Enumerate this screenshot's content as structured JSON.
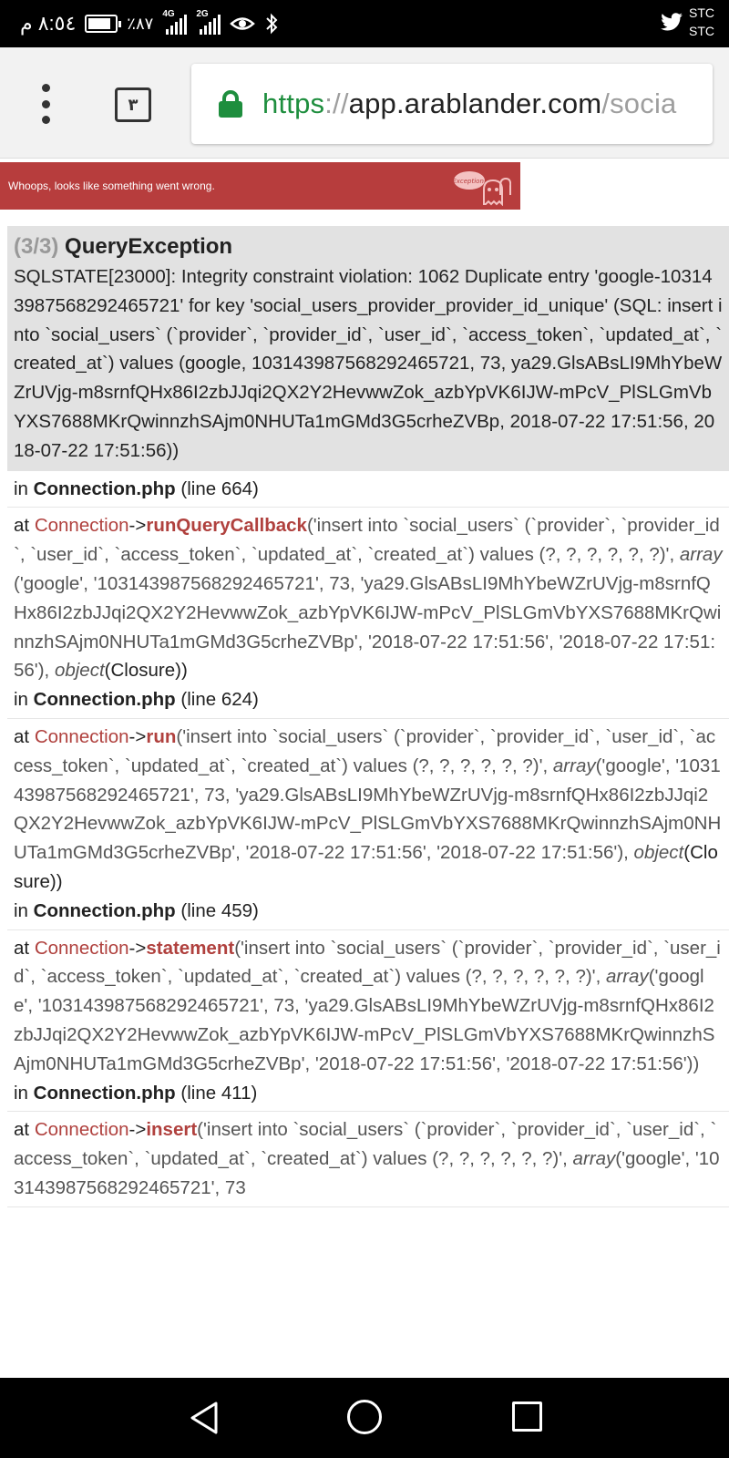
{
  "status_bar": {
    "time": "٨:٥٤ م",
    "battery_percent": "٪٨٧",
    "battery_level": 0.87,
    "net1": "4G",
    "net2": "2G",
    "carrier1": "STC",
    "carrier2": "STC",
    "icons": [
      "battery-icon",
      "signal-icon",
      "eye-icon",
      "bluetooth-icon",
      "twitter-icon"
    ]
  },
  "browser": {
    "tab_count": "٣",
    "url_scheme": "https",
    "url_sep": "://",
    "url_host": "app.arablander.com",
    "url_path": "/socia"
  },
  "banner": {
    "text": "Whoops, looks like something went wrong.",
    "logo_text": "Exception!",
    "color": "#b73d3d"
  },
  "exception": {
    "count": "(3/3)",
    "class": "QueryException",
    "message": "SQLSTATE[23000]: Integrity constraint violation: 1062 Duplicate entry 'google-103143987568292465721' for key 'social_users_provider_provider_id_unique' (SQL: insert into `social_users` (`provider`, `provider_id`, `user_id`, `access_token`, `updated_at`, `created_at`) values (google, 103143987568292465721, 73, ya29.GlsABsLI9MhYbeWZrUVjg-m8srnfQHx86I2zbJJqi2QX2Y2HevwwZok_azbYpVK6IJW-mPcV_PlSLGmVbYXS7688MKrQwinnzhSAjm0NHUTa1mGMd3G5crheZVBp, 2018-07-22 17:51:56, 2018-07-22 17:51:56))"
  },
  "trace": {
    "in_label": "in",
    "at_label": "at",
    "frame0": {
      "file": "Connection.php",
      "line": "(line 664)"
    },
    "frame1": {
      "class": "Connection",
      "arrow": "->",
      "method": "runQueryCallback",
      "args_a": "('insert into `social_users` (`provider`, `provider_id`, `user_id`, `access_token`, `updated_at`, `created_at`) values (?, ?, ?, ?, ?, ?)', ",
      "array_kw": "array",
      "args_b": "('google', '103143987568292465721', 73, 'ya29.GlsABsLI9MhYbeWZrUVjg-m8srnfQHx86I2zbJJqi2QX2Y2HevwwZok_azbYpVK6IJW-mPcV_PlSLGmVbYXS7688MKrQwinnzhSAjm0NHUTa1mGMd3G5crheZVBp', '2018-07-22 17:51:56', '2018-07-22 17:51:56'), ",
      "object_kw": "object",
      "args_c": "(Closure))",
      "file": "Connection.php",
      "line": "(line 624)"
    },
    "frame2": {
      "class": "Connection",
      "arrow": "->",
      "method": "run",
      "args_a": "('insert into `social_users` (`provider`, `provider_id`, `user_id`, `access_token`, `updated_at`, `created_at`) values (?, ?, ?, ?, ?, ?)', ",
      "array_kw": "array",
      "args_b": "('google', '103143987568292465721', 73, 'ya29.GlsABsLI9MhYbeWZrUVjg-m8srnfQHx86I2zbJJqi2QX2Y2HevwwZok_azbYpVK6IJW-mPcV_PlSLGmVbYXS7688MKrQwinnzhSAjm0NHUTa1mGMd3G5crheZVBp', '2018-07-22 17:51:56', '2018-07-22 17:51:56'), ",
      "object_kw": "object",
      "args_c": "(Closure))",
      "file": "Connection.php",
      "line": "(line 459)"
    },
    "frame3": {
      "class": "Connection",
      "arrow": "->",
      "method": "statement",
      "args_a": "('insert into `social_users` (`provider`, `provider_id`, `user_id`, `access_token`, `updated_at`, `created_at`) values (?, ?, ?, ?, ?, ?)', ",
      "array_kw": "array",
      "args_b": "('google', '103143987568292465721', 73, 'ya29.GlsABsLI9MhYbeWZrUVjg-m8srnfQHx86I2zbJJqi2QX2Y2HevwwZok_azbYpVK6IJW-mPcV_PlSLGmVbYXS7688MKrQwinnzhSAjm0NHUTa1mGMd3G5crheZVBp', '2018-07-22 17:51:56', '2018-07-22 17:51:56'))",
      "file": "Connection.php",
      "line": "(line 411)"
    },
    "frame4": {
      "class": "Connection",
      "arrow": "->",
      "method": "insert",
      "args_a": "('insert into `social_users` (`provider`, `provider_id`, `user_id`, `access_token`, `updated_at`, `created_at`) values (?, ?, ?, ?, ?, ?)', ",
      "array_kw": "array",
      "args_b": "('google', '103143987568292465721', 73"
    }
  },
  "nav": {
    "icons": [
      "back-icon",
      "home-icon",
      "recent-apps-icon"
    ]
  }
}
